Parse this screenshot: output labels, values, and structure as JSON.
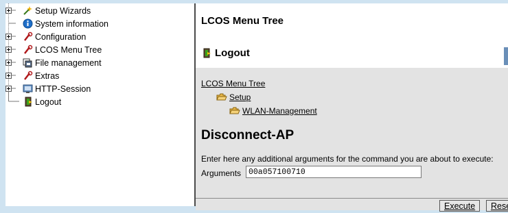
{
  "tree": {
    "items": [
      {
        "label": "Setup Wizards",
        "icon": "wand-icon",
        "expandable": true
      },
      {
        "label": "System information",
        "icon": "info-icon",
        "expandable": false
      },
      {
        "label": "Configuration",
        "icon": "tool-icon",
        "expandable": true
      },
      {
        "label": "LCOS Menu Tree",
        "icon": "tool-icon",
        "expandable": true
      },
      {
        "label": "File management",
        "icon": "files-icon",
        "expandable": true
      },
      {
        "label": "Extras",
        "icon": "tool-icon",
        "expandable": true
      },
      {
        "label": "HTTP-Session",
        "icon": "monitor-icon",
        "expandable": true
      },
      {
        "label": "Logout",
        "icon": "door-exit-icon",
        "expandable": false
      }
    ]
  },
  "header": {
    "title": "LCOS Menu Tree",
    "section": "Logout"
  },
  "breadcrumb": [
    {
      "label": "LCOS Menu Tree"
    },
    {
      "label": "Setup",
      "icon": "folder-icon"
    },
    {
      "label": "WLAN-Management",
      "icon": "folder-icon"
    }
  ],
  "page": {
    "title": "Disconnect-AP",
    "instruction": "Enter here any additional arguments for the command you are about to execute:",
    "arguments_label": "Arguments",
    "arguments_value": "00a057100710"
  },
  "buttons": {
    "execute": "Execute",
    "reset": "Reset"
  },
  "colors": {
    "frame": "#cfe3f1",
    "panel": "#e3e3e3",
    "accent": "#6a8fb8"
  }
}
